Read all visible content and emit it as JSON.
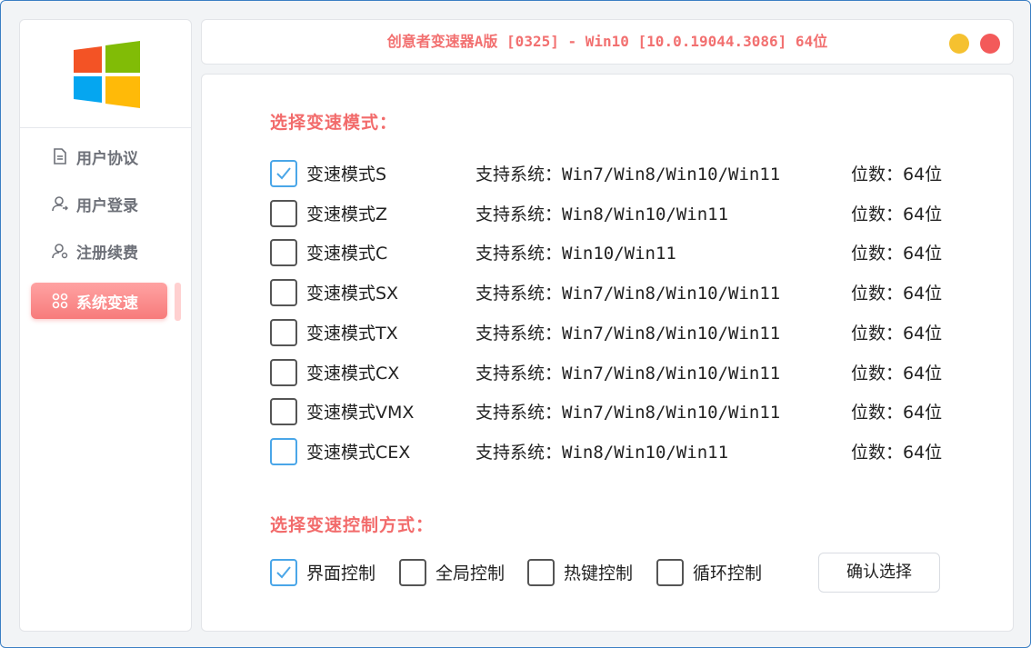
{
  "window": {
    "title": "创意者变速器A版 [0325]  - Win10 [10.0.19044.3086] 64位"
  },
  "sidebar": {
    "items": [
      {
        "label": "用户协议",
        "icon": "document-icon",
        "active": false
      },
      {
        "label": "用户登录",
        "icon": "user-login-icon",
        "active": false
      },
      {
        "label": "注册续费",
        "icon": "user-settings-icon",
        "active": false
      },
      {
        "label": "系统变速",
        "icon": "grid-icon",
        "active": true
      }
    ]
  },
  "main": {
    "mode_section_title": "选择变速模式：",
    "modes": [
      {
        "name": "变速模式S",
        "systems": "支持系统：Win7/Win8/Win10/Win11",
        "bits": "位数：64位",
        "checked": true
      },
      {
        "name": "变速模式Z",
        "systems": "支持系统：Win8/Win10/Win11",
        "bits": "位数：64位",
        "checked": false
      },
      {
        "name": "变速模式C",
        "systems": "支持系统：Win10/Win11",
        "bits": "位数：64位",
        "checked": false
      },
      {
        "name": "变速模式SX",
        "systems": "支持系统：Win7/Win8/Win10/Win11",
        "bits": "位数：64位",
        "checked": false
      },
      {
        "name": "变速模式TX",
        "systems": "支持系统：Win7/Win8/Win10/Win11",
        "bits": "位数：64位",
        "checked": false
      },
      {
        "name": "变速模式CX",
        "systems": "支持系统：Win7/Win8/Win10/Win11",
        "bits": "位数：64位",
        "checked": false
      },
      {
        "name": "变速模式VMX",
        "systems": "支持系统：Win7/Win8/Win10/Win11",
        "bits": "位数：64位",
        "checked": false
      },
      {
        "name": "变速模式CEX",
        "systems": "支持系统：Win8/Win10/Win11",
        "bits": "位数：64位",
        "checked": false
      }
    ],
    "control_section_title": "选择变速控制方式：",
    "controls": [
      {
        "label": "界面控制",
        "checked": true
      },
      {
        "label": "全局控制",
        "checked": false
      },
      {
        "label": "热键控制",
        "checked": false
      },
      {
        "label": "循环控制",
        "checked": false
      }
    ],
    "confirm_label": "确认选择"
  },
  "colors": {
    "accent": "#f26b6b",
    "checkbox_blue": "#4aa6e8",
    "minimize": "#f5c130",
    "close": "#f35a5a"
  }
}
